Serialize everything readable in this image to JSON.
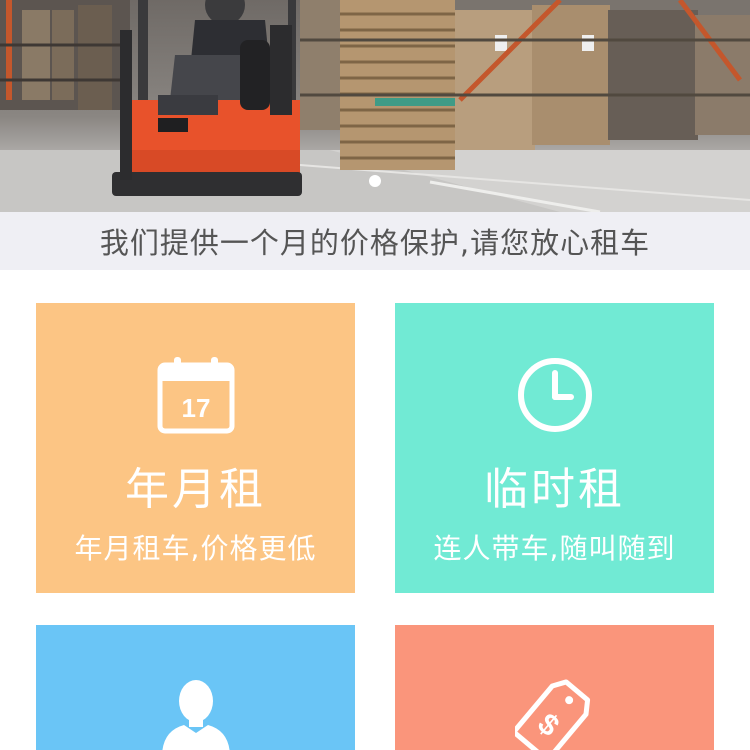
{
  "banner": {
    "slide_count": 1,
    "active_slide": 1
  },
  "notice": {
    "text": "我们提供一个月的价格保护,请您放心租车"
  },
  "tiles": [
    {
      "title": "年月租",
      "subtitle": "年月租车,价格更低",
      "icon": "calendar-icon",
      "calendar_day": "17",
      "color": "#fcc584"
    },
    {
      "title": "临时租",
      "subtitle": "连人带车,随叫随到",
      "icon": "clock-icon",
      "color": "#71ead4"
    },
    {
      "title": "",
      "subtitle": "",
      "icon": "person-icon",
      "color": "#6ac5f6"
    },
    {
      "title": "",
      "subtitle": "",
      "icon": "price-tag-icon",
      "color": "#fa957b"
    }
  ]
}
